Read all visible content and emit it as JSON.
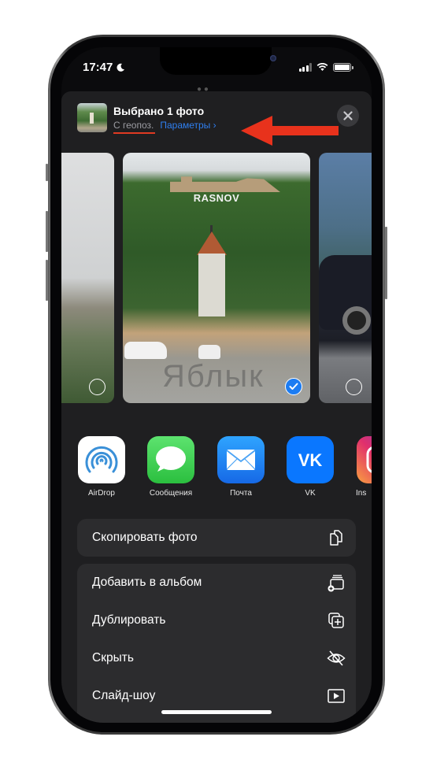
{
  "status_bar": {
    "time": "17:47",
    "focus_icon": "moon-icon",
    "signal_icon": "cellular-signal-icon",
    "wifi_icon": "wifi-icon",
    "battery_icon": "battery-icon"
  },
  "share_sheet": {
    "title": "Выбрано 1 фото",
    "geo_label": "С геопоз.",
    "options_link": "Параметры",
    "options_chevron": "›",
    "close_icon": "close-icon",
    "annotation_arrow": "red-arrow-pointing-left"
  },
  "photos": [
    {
      "name": "previous-photo",
      "selected": false
    },
    {
      "name": "selected-photo",
      "caption_in_image": "RASNOV",
      "watermark": "Яблык",
      "selected": true
    },
    {
      "name": "next-photo",
      "selected": false
    }
  ],
  "apps": [
    {
      "label": "AirDrop",
      "icon": "airdrop-icon",
      "color": "#ffffff"
    },
    {
      "label": "Сообщения",
      "icon": "messages-icon",
      "color": "#34c759"
    },
    {
      "label": "Почта",
      "icon": "mail-icon",
      "color": "#1e8cf5"
    },
    {
      "label": "VK",
      "icon": "vk-icon",
      "color": "#0a77ff"
    },
    {
      "label": "Ins",
      "icon": "instagram-icon",
      "color": "#c13584"
    }
  ],
  "actions_primary": [
    {
      "label": "Скопировать фото",
      "icon": "copy-icon"
    }
  ],
  "actions_secondary": [
    {
      "label": "Добавить в альбом",
      "icon": "add-to-album-icon"
    },
    {
      "label": "Дублировать",
      "icon": "duplicate-icon"
    },
    {
      "label": "Скрыть",
      "icon": "hide-eye-slash-icon"
    },
    {
      "label": "Слайд-шоу",
      "icon": "slideshow-play-icon"
    }
  ],
  "colors": {
    "sheet_background": "#1f1f21",
    "group_background": "#2c2c2e",
    "link_blue": "#2f7ff0",
    "annotation_red": "#e03a22",
    "selection_blue": "#1c7cf2"
  }
}
